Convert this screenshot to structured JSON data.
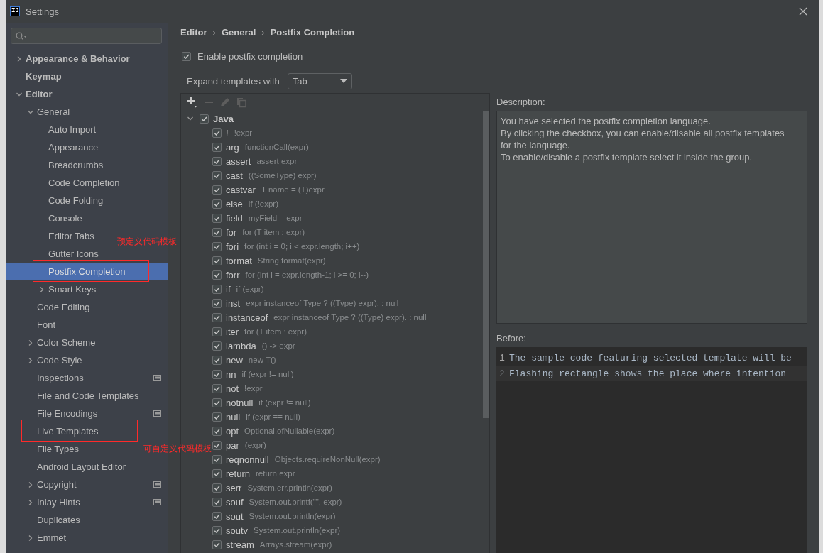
{
  "window": {
    "title": "Settings",
    "logo": "IJ"
  },
  "sidebar": {
    "items": [
      {
        "label": "Appearance & Behavior",
        "kind": "folder",
        "expanded": false,
        "selected": false
      },
      {
        "label": "Keymap",
        "kind": "page",
        "selected": false
      },
      {
        "label": "Editor",
        "kind": "folder",
        "expanded": true,
        "selected": false,
        "children": [
          {
            "label": "General",
            "kind": "folder",
            "expanded": true,
            "selected": false,
            "children": [
              {
                "label": "Auto Import",
                "kind": "page",
                "selected": false
              },
              {
                "label": "Appearance",
                "kind": "page",
                "selected": false
              },
              {
                "label": "Breadcrumbs",
                "kind": "page",
                "selected": false
              },
              {
                "label": "Code Completion",
                "kind": "page",
                "selected": false
              },
              {
                "label": "Code Folding",
                "kind": "page",
                "selected": false
              },
              {
                "label": "Console",
                "kind": "page",
                "selected": false
              },
              {
                "label": "Editor Tabs",
                "kind": "page",
                "selected": false
              },
              {
                "label": "Gutter Icons",
                "kind": "page",
                "selected": false
              },
              {
                "label": "Postfix Completion",
                "kind": "page",
                "selected": true,
                "framed": true
              },
              {
                "label": "Smart Keys",
                "kind": "folder",
                "expanded": false,
                "selected": false
              }
            ]
          },
          {
            "label": "Code Editing",
            "kind": "page",
            "selected": false
          },
          {
            "label": "Font",
            "kind": "page",
            "selected": false
          },
          {
            "label": "Color Scheme",
            "kind": "folder",
            "expanded": false,
            "selected": false
          },
          {
            "label": "Code Style",
            "kind": "folder",
            "expanded": false,
            "selected": false
          },
          {
            "label": "Inspections",
            "kind": "page",
            "selected": false,
            "project_scope": true
          },
          {
            "label": "File and Code Templates",
            "kind": "page",
            "selected": false
          },
          {
            "label": "File Encodings",
            "kind": "page",
            "selected": false,
            "project_scope": true
          },
          {
            "label": "Live Templates",
            "kind": "page",
            "selected": false,
            "framed": true
          },
          {
            "label": "File Types",
            "kind": "page",
            "selected": false
          },
          {
            "label": "Android Layout Editor",
            "kind": "page",
            "selected": false
          },
          {
            "label": "Copyright",
            "kind": "folder",
            "expanded": false,
            "selected": false,
            "project_scope": true
          },
          {
            "label": "Inlay Hints",
            "kind": "folder",
            "expanded": false,
            "selected": false,
            "project_scope": true
          },
          {
            "label": "Duplicates",
            "kind": "page",
            "selected": false
          },
          {
            "label": "Emmet",
            "kind": "folder",
            "expanded": false,
            "selected": false
          }
        ]
      }
    ]
  },
  "annotations": [
    {
      "text": "预定义代码模板"
    },
    {
      "text": "可自定义代码模板"
    }
  ],
  "breadcrumb": {
    "separator": "›",
    "items": [
      "Editor",
      "General",
      "Postfix Completion"
    ]
  },
  "enable": {
    "label": "Enable postfix completion",
    "checked": true
  },
  "expand": {
    "label": "Expand templates with",
    "value": "Tab"
  },
  "toolbar": [
    {
      "kind": "add",
      "disabled": false
    },
    {
      "kind": "remove",
      "disabled": true
    },
    {
      "kind": "edit",
      "disabled": true
    },
    {
      "kind": "copy",
      "disabled": true
    }
  ],
  "templates": [
    {
      "name": "Java",
      "checked": true,
      "expanded": true,
      "children": [
        {
          "name": "!",
          "example": "!expr",
          "checked": true
        },
        {
          "name": "arg",
          "example": "functionCall(expr)",
          "checked": true
        },
        {
          "name": "assert",
          "example": "assert expr",
          "checked": true
        },
        {
          "name": "cast",
          "example": "((SomeType) expr)",
          "checked": true
        },
        {
          "name": "castvar",
          "example": "T name = (T)expr",
          "checked": true
        },
        {
          "name": "else",
          "example": "if (!expr)",
          "checked": true
        },
        {
          "name": "field",
          "example": "myField = expr",
          "checked": true
        },
        {
          "name": "for",
          "example": "for (T item : expr)",
          "checked": true
        },
        {
          "name": "fori",
          "example": "for (int i = 0; i < expr.length; i++)",
          "checked": true
        },
        {
          "name": "format",
          "example": "String.format(expr)",
          "checked": true
        },
        {
          "name": "forr",
          "example": "for (int i = expr.length-1; i >= 0; i--)",
          "checked": true
        },
        {
          "name": "if",
          "example": "if (expr)",
          "checked": true
        },
        {
          "name": "inst",
          "example": "expr instanceof Type ? ((Type) expr). : null",
          "checked": true
        },
        {
          "name": "instanceof",
          "example": "expr instanceof Type ? ((Type) expr). : null",
          "checked": true
        },
        {
          "name": "iter",
          "example": "for (T item : expr)",
          "checked": true
        },
        {
          "name": "lambda",
          "example": "() -> expr",
          "checked": true
        },
        {
          "name": "new",
          "example": "new T()",
          "checked": true
        },
        {
          "name": "nn",
          "example": "if (expr != null)",
          "checked": true
        },
        {
          "name": "not",
          "example": "!expr",
          "checked": true
        },
        {
          "name": "notnull",
          "example": "if (expr != null)",
          "checked": true
        },
        {
          "name": "null",
          "example": "if (expr == null)",
          "checked": true
        },
        {
          "name": "opt",
          "example": "Optional.ofNullable(expr)",
          "checked": true
        },
        {
          "name": "par",
          "example": "(expr)",
          "checked": true
        },
        {
          "name": "reqnonnull",
          "example": "Objects.requireNonNull(expr)",
          "checked": true
        },
        {
          "name": "return",
          "example": "return expr",
          "checked": true
        },
        {
          "name": "serr",
          "example": "System.err.println(expr)",
          "checked": true
        },
        {
          "name": "souf",
          "example": "System.out.printf(\"\", expr)",
          "checked": true
        },
        {
          "name": "sout",
          "example": "System.out.println(expr)",
          "checked": true
        },
        {
          "name": "soutv",
          "example": "System.out.println(expr)",
          "checked": true
        },
        {
          "name": "stream",
          "example": "Arrays.stream(expr)",
          "checked": true
        }
      ]
    }
  ],
  "description": {
    "label": "Description:",
    "lines": [
      "You have selected the postfix completion language.",
      "By clicking the checkbox, you can enable/disable all postfix templates for the language.",
      "To enable/disable a postfix template select it inside the group."
    ]
  },
  "before": {
    "label": "Before:",
    "lines": [
      {
        "number": "1",
        "text": "The sample code featuring selected template will be",
        "current": true
      },
      {
        "number": "2",
        "text": "Flashing rectangle shows the place where intention",
        "current": false
      }
    ]
  }
}
